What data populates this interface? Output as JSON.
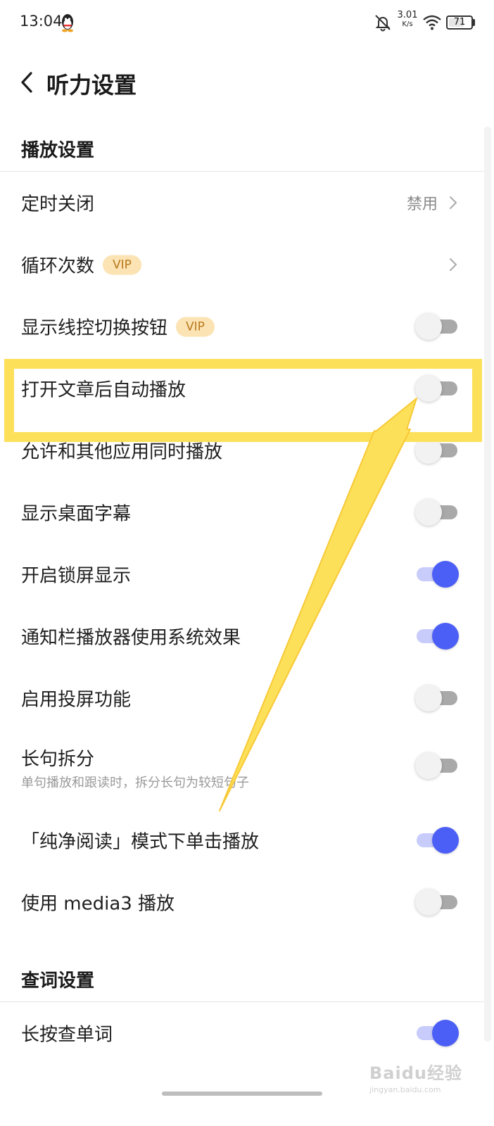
{
  "status_bar": {
    "time": "13:04",
    "net_speed_value": "3.01",
    "net_speed_unit": "K/s",
    "battery": "71"
  },
  "header": {
    "title": "听力设置"
  },
  "sections": [
    {
      "title": "播放设置"
    },
    {
      "title": "查词设置"
    }
  ],
  "rows": [
    {
      "label": "定时关闭",
      "value": "禁用"
    },
    {
      "label": "循环次数",
      "badge": "VIP"
    },
    {
      "label": "显示线控切换按钮",
      "badge": "VIP",
      "enabled": false
    },
    {
      "label": "打开文章后自动播放",
      "enabled": false
    },
    {
      "label": "允许和其他应用同时播放",
      "enabled": false
    },
    {
      "label": "显示桌面字幕",
      "enabled": false
    },
    {
      "label": "开启锁屏显示",
      "enabled": true
    },
    {
      "label": "通知栏播放器使用系统效果",
      "enabled": true
    },
    {
      "label": "启用投屏功能",
      "enabled": false
    },
    {
      "label": "长句拆分",
      "sub": "单句播放和跟读时，拆分长句为较短句子",
      "enabled": false
    },
    {
      "label": "「纯净阅读」模式下单击播放",
      "enabled": true
    },
    {
      "label": "使用 media3 播放",
      "enabled": false
    },
    {
      "label": "长按查单词",
      "enabled": true
    }
  ],
  "annotation": {
    "highlight_color": "#fde05a",
    "highlight_target": "打开文章后自动播放"
  },
  "colors": {
    "toggle_on": "#4b5ff6",
    "toggle_on_track": "#c7ccfb",
    "toggle_off_track": "#a9a9a9",
    "vip_bg": "#fbe3b4",
    "vip_text": "#b9791c"
  },
  "watermark": {
    "logo": "Baidu经验",
    "sub": "jingyan.baidu.com"
  }
}
